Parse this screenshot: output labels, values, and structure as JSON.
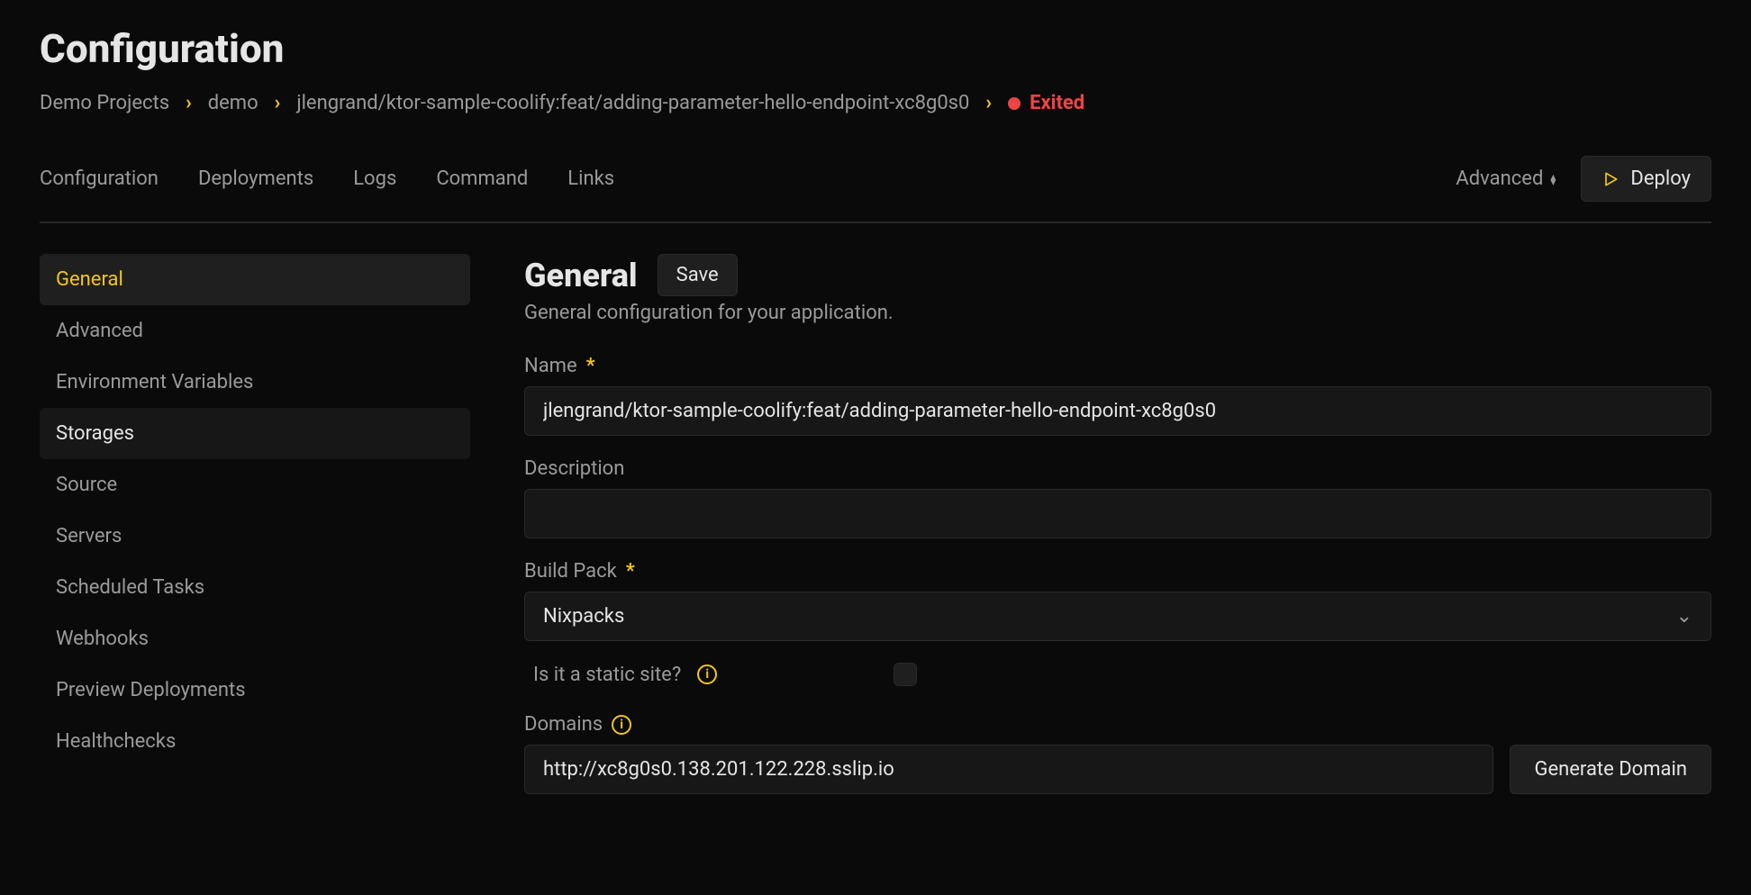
{
  "page": {
    "title": "Configuration"
  },
  "breadcrumb": {
    "items": [
      "Demo Projects",
      "demo",
      "jlengrand/ktor-sample-coolify:feat/adding-parameter-hello-endpoint-xc8g0s0"
    ],
    "status": {
      "label": "Exited",
      "color": "#ef4444"
    }
  },
  "tabs": {
    "items": [
      "Configuration",
      "Deployments",
      "Logs",
      "Command",
      "Links"
    ],
    "advanced_label": "Advanced",
    "deploy_label": "Deploy"
  },
  "sidebar": {
    "items": [
      {
        "label": "General",
        "state": "active"
      },
      {
        "label": "Advanced",
        "state": ""
      },
      {
        "label": "Environment Variables",
        "state": ""
      },
      {
        "label": "Storages",
        "state": "hover"
      },
      {
        "label": "Source",
        "state": ""
      },
      {
        "label": "Servers",
        "state": ""
      },
      {
        "label": "Scheduled Tasks",
        "state": ""
      },
      {
        "label": "Webhooks",
        "state": ""
      },
      {
        "label": "Preview Deployments",
        "state": ""
      },
      {
        "label": "Healthchecks",
        "state": ""
      }
    ]
  },
  "section": {
    "title": "General",
    "save_label": "Save",
    "subtitle": "General configuration for your application."
  },
  "form": {
    "name_label": "Name",
    "name_value": "jlengrand/ktor-sample-coolify:feat/adding-parameter-hello-endpoint-xc8g0s0",
    "description_label": "Description",
    "description_value": "",
    "buildpack_label": "Build Pack",
    "buildpack_value": "Nixpacks",
    "static_label": "Is it a static site?",
    "static_checked": false,
    "domains_label": "Domains",
    "domains_value": "http://xc8g0s0.138.201.122.228.sslip.io",
    "generate_domain_label": "Generate Domain"
  }
}
